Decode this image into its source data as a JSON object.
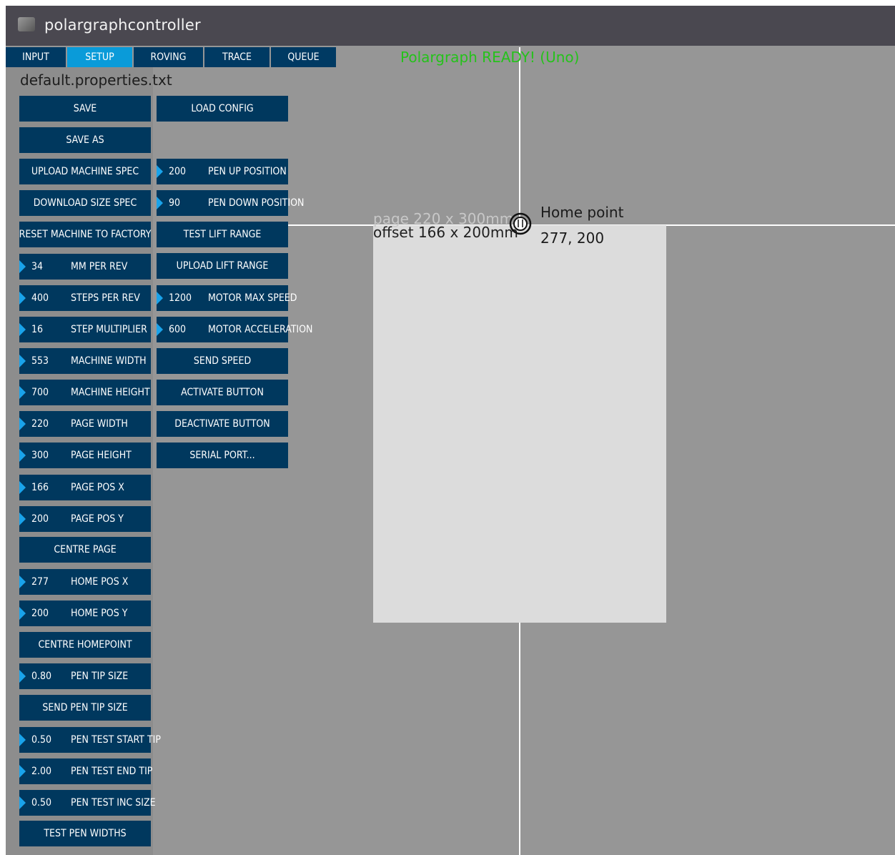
{
  "window": {
    "title": "polargraphcontroller"
  },
  "tabs": [
    {
      "label": "INPUT",
      "active": false
    },
    {
      "label": "SETUP",
      "active": true
    },
    {
      "label": "ROVING",
      "active": false
    },
    {
      "label": "TRACE",
      "active": false
    },
    {
      "label": "QUEUE",
      "active": false
    }
  ],
  "status": "Polargraph READY! (Uno)",
  "properties_file": "default.properties.txt",
  "left_column": {
    "save": "SAVE",
    "save_as": "SAVE AS",
    "upload_machine_spec": "UPLOAD MACHINE SPEC",
    "download_size_spec": "DOWNLOAD SIZE SPEC",
    "reset_machine": "RESET MACHINE TO FACTORY",
    "mm_per_rev": {
      "value": "34",
      "label": "MM PER REV"
    },
    "steps_per_rev": {
      "value": "400",
      "label": "STEPS PER REV"
    },
    "step_multiplier": {
      "value": "16",
      "label": "STEP MULTIPLIER"
    },
    "machine_width": {
      "value": "553",
      "label": "MACHINE WIDTH"
    },
    "machine_height": {
      "value": "700",
      "label": "MACHINE HEIGHT"
    },
    "page_width": {
      "value": "220",
      "label": "PAGE WIDTH"
    },
    "page_height": {
      "value": "300",
      "label": "PAGE HEIGHT"
    },
    "page_pos_x": {
      "value": "166",
      "label": "PAGE POS X"
    },
    "page_pos_y": {
      "value": "200",
      "label": "PAGE POS Y"
    },
    "centre_page": "CENTRE PAGE",
    "home_pos_x": {
      "value": "277",
      "label": "HOME POS X"
    },
    "home_pos_y": {
      "value": "200",
      "label": "HOME POS Y"
    },
    "centre_homepoint": "CENTRE HOMEPOINT",
    "pen_tip_size": {
      "value": "0.80",
      "label": "PEN TIP SIZE"
    },
    "send_pen_tip_size": "SEND PEN TIP SIZE",
    "pen_test_start_tip": {
      "value": "0.50",
      "label": "PEN TEST START TIP"
    },
    "pen_test_end_tip": {
      "value": "2.00",
      "label": "PEN TEST END TIP"
    },
    "pen_test_inc_size": {
      "value": "0.50",
      "label": "PEN TEST INC SIZE"
    },
    "test_pen_widths": "TEST PEN WIDTHS"
  },
  "right_column": {
    "load_config": "LOAD CONFIG",
    "pen_up_position": {
      "value": "200",
      "label": "PEN UP POSITION"
    },
    "pen_down_position": {
      "value": "90",
      "label": "PEN DOWN POSITION"
    },
    "test_lift_range": "TEST LIFT RANGE",
    "upload_lift_range": "UPLOAD LIFT RANGE",
    "motor_max_speed": {
      "value": "1200",
      "label": "MOTOR MAX SPEED"
    },
    "motor_acceleration": {
      "value": "600",
      "label": "MOTOR ACCELERATION"
    },
    "send_speed": "SEND SPEED",
    "activate_button": "ACTIVATE BUTTON",
    "deactivate_button": "DEACTIVATE BUTTON",
    "serial_port": "SERIAL PORT..."
  },
  "canvas": {
    "page_label": "page 220 x 300mm",
    "offset_label": "offset 166 x 200mm",
    "home_title": "Home point",
    "home_coords": "277, 200"
  }
}
